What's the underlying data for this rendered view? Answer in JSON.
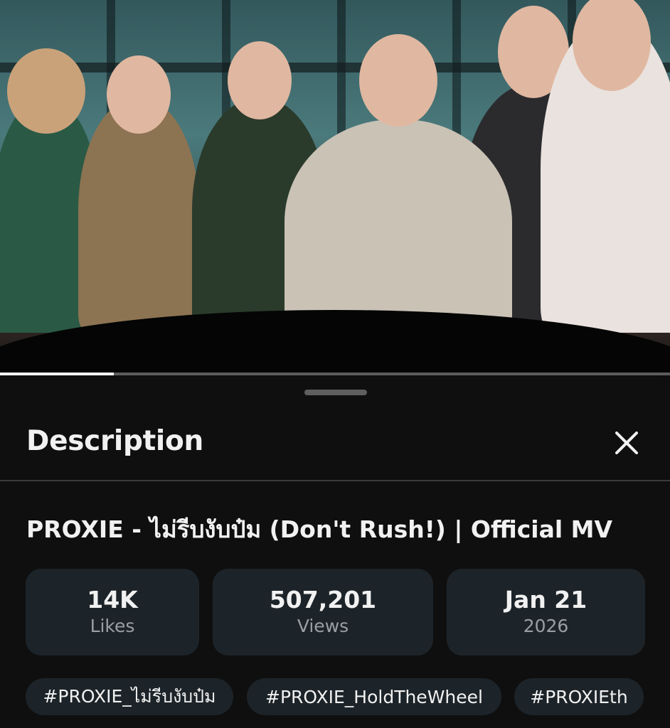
{
  "video": {
    "progress_fraction": 0.17
  },
  "sheet": {
    "title": "Description",
    "close_icon": "close-icon"
  },
  "details": {
    "title": "PROXIE - ไม่รีบงับป๋ม (Don't Rush!) | Official MV",
    "stats": [
      {
        "value": "14K",
        "label": "Likes"
      },
      {
        "value": "507,201",
        "label": "Views"
      },
      {
        "value": "Jan 21",
        "label": "2026"
      }
    ],
    "hashtags": [
      "#PROXIE_ไม่รีบงับป๋ม",
      "#PROXIE_HoldTheWheel",
      "#PROXIEth"
    ]
  },
  "colors": {
    "background": "#0f0f0f",
    "card": "#1d2429",
    "text_primary": "#f1f1f1",
    "text_secondary": "#9a9fa3"
  }
}
